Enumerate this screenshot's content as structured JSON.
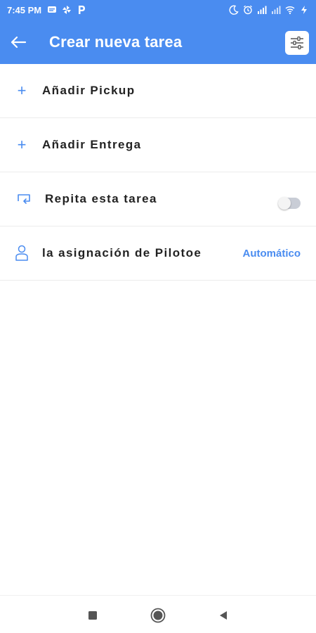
{
  "status_bar": {
    "time": "7:45 PM",
    "left_icons": [
      "message-icon",
      "pinwheel-icon",
      "p-app-icon"
    ],
    "right_icons": [
      "moon-icon",
      "alarm-icon",
      "signal-icon",
      "signal-icon-2",
      "wifi-icon",
      "battery-charging-icon"
    ]
  },
  "app_bar": {
    "title": "Crear nueva tarea",
    "back_icon": "arrow-left-icon",
    "filter_icon": "sliders-icon",
    "color": "#4a8cf0"
  },
  "rows": [
    {
      "label": "Añadir Pickup",
      "icon": "plus-icon"
    },
    {
      "label": "Añadir Entrega",
      "icon": "plus-icon"
    },
    {
      "label": "Repita esta tarea",
      "icon": "repeat-icon",
      "toggle_on": false
    },
    {
      "label": "la asignación de Pilotoe",
      "icon": "person-icon",
      "value": "Automático"
    }
  ],
  "nav_bar": {
    "icons": [
      "recent-apps-icon",
      "home-icon",
      "back-triangle-icon"
    ]
  }
}
